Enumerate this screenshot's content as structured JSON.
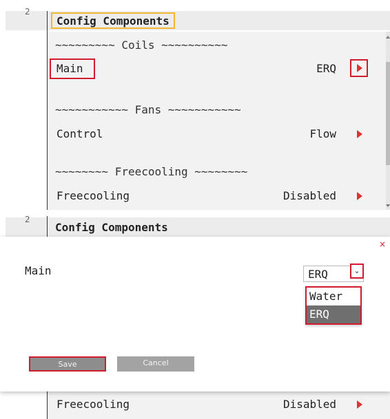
{
  "top": {
    "gutter_number": "2",
    "title": "Config Components",
    "sections": {
      "coils_sep": "~~~~~~~~~ Coils ~~~~~~~~~~",
      "fans_sep": "~~~~~~~~~~~ Fans ~~~~~~~~~~~",
      "freecooling_sep": "~~~~~~~~ Freecooling ~~~~~~~~"
    },
    "rows": {
      "main": {
        "label": "Main",
        "value": "ERQ"
      },
      "control": {
        "label": "Control",
        "value": "Flow"
      },
      "freecooling": {
        "label": "Freecooling",
        "value": "Disabled"
      }
    }
  },
  "bottom": {
    "gutter_number": "2",
    "title": "Config Components",
    "modal": {
      "close": "×",
      "label": "Main",
      "selected": "ERQ",
      "chevron": "⌄",
      "options": [
        "Water",
        "ERQ"
      ],
      "save_label": "Save",
      "cancel_label": "Cancel"
    },
    "row": {
      "label": "Freecooling",
      "value": "Disabled"
    }
  },
  "colors": {
    "highlight_red": "#d11b2f",
    "title_highlight": "#f2b632",
    "arrow": "#dd3333"
  }
}
